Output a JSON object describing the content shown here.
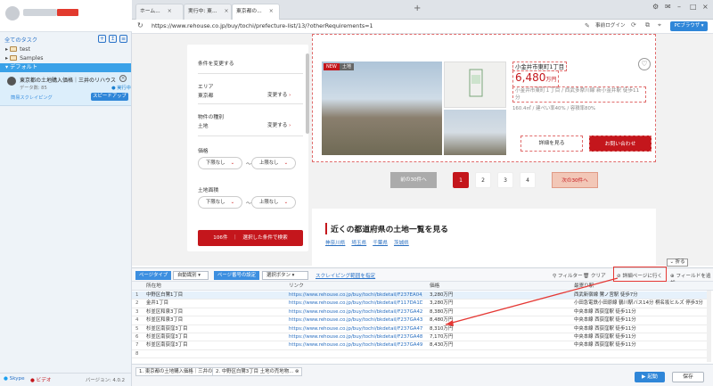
{
  "sidebar": {
    "all_tasks": "全てのタスク",
    "tree": [
      {
        "label": "test"
      },
      {
        "label": "Samples"
      }
    ],
    "default_group": "デフォルト",
    "task": {
      "title": "東京都の土地購入価格｜三井のリハウスス...",
      "sub": "データ数: 85",
      "status": "実行中",
      "mode": "簡易スクレイピング",
      "speedup": "スピードアップ"
    },
    "footer": {
      "skype": "Skype",
      "video": "ビデオ",
      "version": "バージョン: 4.0.2"
    }
  },
  "browser": {
    "tabs": [
      {
        "label": "ホーム..."
      },
      {
        "label": "実行中: 東..."
      },
      {
        "label": "東京都の..."
      }
    ],
    "url": "https://www.rehouse.co.jp/buy/tochi/prefecture-list/13/?otherRequirements=1",
    "login": "事前ログイン",
    "pc_mode": "PCブラウザ"
  },
  "web": {
    "filter": {
      "change_cond": "条件を変更する",
      "area_label": "エリア",
      "area_value": "東京都",
      "change": "変更する",
      "type_label": "物件の種別",
      "type_value": "土地",
      "price_label": "価格",
      "lower": "下限なし",
      "upper": "上限なし",
      "area_size_label": "土地面積",
      "count": "106件",
      "search": "選択した条件で検索"
    },
    "listing": {
      "new_badge": "NEW",
      "cat_badge": "土地",
      "title": "小金井市東町1丁目",
      "price": "6,480",
      "price_unit": "万円",
      "address": "小金井市東町１丁目 / 西武多摩川線 新小金井駅 徒歩11分",
      "spec": "160.4㎡ / 建ぺい率40% / 容積率80%",
      "detail": "詳細を見る",
      "inquire": "お問い合わせ"
    },
    "pager": {
      "prev": "前の30件へ",
      "pages": [
        "1",
        "2",
        "3",
        "4"
      ],
      "current": "1",
      "next": "次の30件へ"
    },
    "nearby": {
      "title": "近くの都道府県の土地一覧を見る",
      "links": [
        "神奈川県",
        "埼玉県",
        "千葉県",
        "茨城県"
      ]
    }
  },
  "extract": {
    "collapse": "折る",
    "page_type_label": "ページタイプ",
    "page_type_value": "自動識別",
    "pager_label": "ページ番号の設定",
    "pager_value": "選択ボタン",
    "range_link": "スクレイピング範囲を指定",
    "filter": "フィルター",
    "clear": "クリア",
    "goto_detail": "詳細ページに行く",
    "add_field": "フィールドを追加",
    "columns": [
      "所在地",
      "リンク",
      "価格",
      "最寄り駅"
    ],
    "rows": [
      [
        "中野区白鷺1丁目",
        "https://www.rehouse.co.jp/buy/tochi/bkdetail/F237EA04/",
        "3,280万円",
        "西武新宿線 鷺ノ宮駅 徒歩7分"
      ],
      [
        "金井1丁目",
        "https://www.rehouse.co.jp/buy/tochi/bkdetail/F117DA1D/",
        "3,280万円",
        "小田急電鉄小田原線 鶴川駅バス14分 桐名坂ヒルズ 停歩3分"
      ],
      [
        "杉並区和泉3丁目",
        "https://www.rehouse.co.jp/buy/tochi/bkdetail/F237GA42/",
        "8,380万円",
        "中央本線 西荻窪駅 徒歩11分"
      ],
      [
        "杉並区和泉3丁目",
        "https://www.rehouse.co.jp/buy/tochi/bkdetail/F237GA43/",
        "8,480万円",
        "中央本線 西荻窪駅 徒歩11分"
      ],
      [
        "杉並区南荻窪3丁目",
        "https://www.rehouse.co.jp/buy/tochi/bkdetail/F237GA47/",
        "8,310万円",
        "中央本線 西荻窪駅 徒歩11分"
      ],
      [
        "杉並区南荻窪3丁目",
        "https://www.rehouse.co.jp/buy/tochi/bkdetail/F237GA48/",
        "7,170万円",
        "中央本線 西荻窪駅 徒歩11分"
      ],
      [
        "杉並区南荻窪3丁目",
        "https://www.rehouse.co.jp/buy/tochi/bkdetail/F237GA49/",
        "8,430万円",
        "中央本線 西荻窪駅 徒歩11分"
      ],
      [
        "",
        "",
        "",
        ""
      ]
    ]
  },
  "bottom": {
    "tabs": [
      "1. 東京都の土地購入価格｜三井の...",
      "2. 中野区白鷺3丁目 土地の売地物..."
    ],
    "start": "起動",
    "save": "保存"
  },
  "colors": {
    "accent": "#2f86d8",
    "brand_red": "#c4161c",
    "highlight": "#e53935"
  }
}
